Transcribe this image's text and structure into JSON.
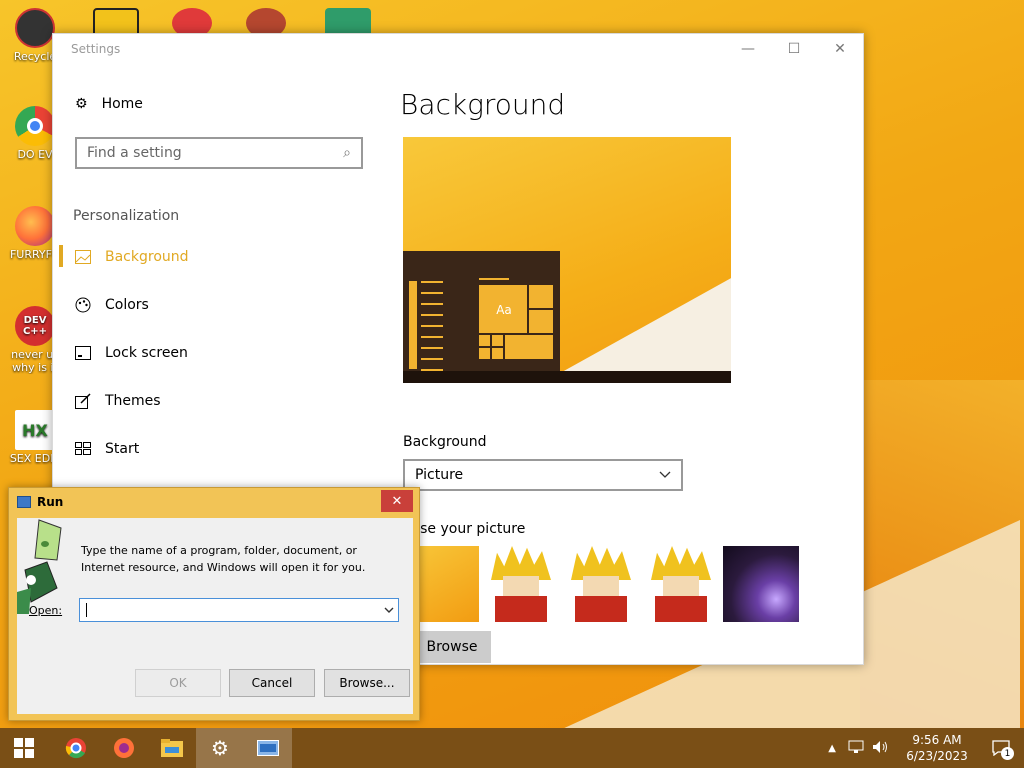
{
  "desktop": {
    "icons": [
      {
        "label": "Recycle",
        "color": "#333333"
      },
      {
        "label": "DO EV",
        "color": "#ea4335"
      },
      {
        "label": "FURRYFU",
        "color": "#ff7139"
      },
      {
        "label": "never us",
        "label2": "why is it",
        "color": "#d32f2f",
        "glyph_text": "DEV C++"
      },
      {
        "label": "SEX EDIT",
        "color": "#ffffff",
        "glyph_text": "HX"
      }
    ]
  },
  "settings": {
    "window_title": "Settings",
    "controls": {
      "minimize": "—",
      "maximize": "☐",
      "close": "✕"
    },
    "nav": {
      "home": "Home",
      "search_placeholder": "Find a setting",
      "section": "Personalization",
      "items": [
        {
          "label": "Background",
          "icon": "image-icon"
        },
        {
          "label": "Colors",
          "icon": "palette-icon"
        },
        {
          "label": "Lock screen",
          "icon": "lock-screen-icon"
        },
        {
          "label": "Themes",
          "icon": "themes-icon"
        },
        {
          "label": "Start",
          "icon": "start-icon"
        }
      ]
    },
    "page_title": "Background",
    "preview_tile_text": "Aa",
    "background_label": "Background",
    "background_value": "Picture",
    "choose_label": "oose your picture",
    "browse_label": "Browse"
  },
  "run": {
    "title": "Run",
    "description": "Type the name of a program, folder, document, or Internet resource, and Windows will open it for you.",
    "open_label": "Open:",
    "input_value": "",
    "ok": "OK",
    "cancel": "Cancel",
    "browse": "Browse..."
  },
  "taskbar": {
    "time": "9:56 AM",
    "date": "6/23/2023",
    "notification_count": "1"
  },
  "colors": {
    "accent": "#e1a923",
    "taskbar": "#7a4f16"
  }
}
